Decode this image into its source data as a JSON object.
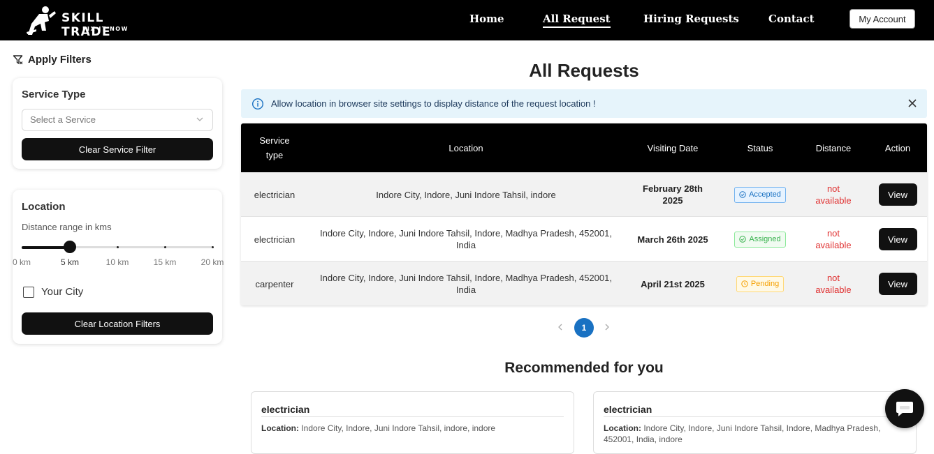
{
  "brand": {
    "title": "SKILL TRADE",
    "subtitle": "FIX IT NOW"
  },
  "nav": {
    "links": [
      "Home",
      "All Request",
      "Hiring Requests",
      "Contact"
    ],
    "active": "All Request",
    "account_label": "My Account"
  },
  "filters": {
    "heading": "Apply Filters",
    "service": {
      "title": "Service Type",
      "placeholder": "Select a Service",
      "clear_label": "Clear Service Filter"
    },
    "location": {
      "title": "Location",
      "range_label": "Distance range in kms",
      "marks": [
        "0 km",
        "5 km",
        "10 km",
        "15 km",
        "20 km"
      ],
      "selected_km": 5,
      "max_km": 20,
      "your_city_label": "Your City",
      "your_city_checked": false,
      "clear_label": "Clear Location Filters"
    }
  },
  "main": {
    "title": "All Requests",
    "alert": "Allow location in browser site settings to display distance of the request location !"
  },
  "table": {
    "headers": [
      "Service type",
      "Location",
      "Visiting Date",
      "Status",
      "Distance",
      "Action"
    ],
    "rows": [
      {
        "service": "electrician",
        "location": "Indore City, Indore, Juni Indore Tahsil, indore",
        "date": "February 28th 2025",
        "status": "Accepted",
        "status_color": "#1971c2",
        "distance": "not available",
        "action": "View"
      },
      {
        "service": "electrician",
        "location": "Indore City, Indore, Juni Indore Tahsil, Indore, Madhya Pradesh, 452001, India",
        "date": "March 26th 2025",
        "status": "Assigned",
        "status_color": "#37b24d",
        "distance": "not available",
        "action": "View"
      },
      {
        "service": "carpenter",
        "location": "Indore City, Indore, Juni Indore Tahsil, Indore, Madhya Pradesh, 452001, India",
        "date": "April 21st 2025",
        "status": "Pending",
        "status_color": "#f59f00",
        "distance": "not available",
        "action": "View"
      }
    ]
  },
  "pagination": {
    "current": "1"
  },
  "recommended": {
    "title": "Recommended for you",
    "location_label": "Location:",
    "cards": [
      {
        "service": "electrician",
        "location": "Indore City, Indore, Juni Indore Tahsil, indore, indore"
      },
      {
        "service": "electrician",
        "location": "Indore City, Indore, Juni Indore Tahsil, Indore, Madhya Pradesh, 452001, India, indore"
      }
    ]
  },
  "icons": {
    "filter": "filter-icon",
    "info": "info-icon",
    "close": "close-icon",
    "chat": "chat-icon",
    "chevron": "chevron-down-icon"
  }
}
